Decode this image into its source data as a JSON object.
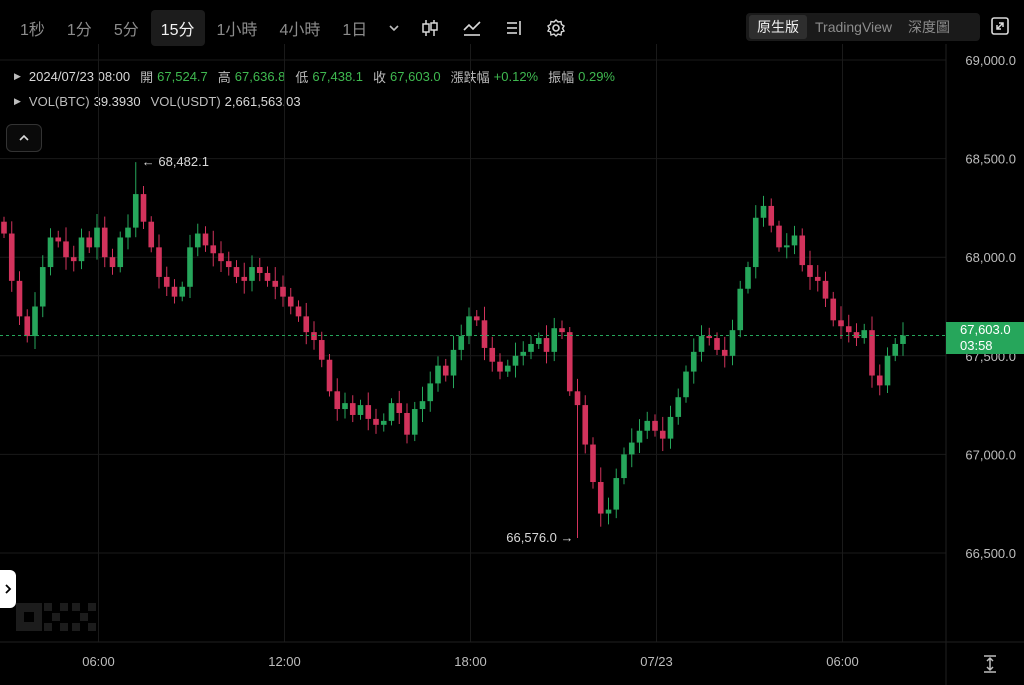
{
  "toolbar": {
    "timeframes": [
      "1秒",
      "1分",
      "5分",
      "15分",
      "1小時",
      "4小時",
      "1日"
    ],
    "active_index": 3,
    "views": [
      "原生版",
      "TradingView",
      "深度圖"
    ],
    "active_view": 0
  },
  "info": {
    "datetime": "2024/07/23 08:00",
    "open_label": "開",
    "open": "67,524.7",
    "high_label": "高",
    "high": "67,636.8",
    "low_label": "低",
    "low": "67,438.1",
    "close_label": "收",
    "close": "67,603.0",
    "change_label": "漲跌幅",
    "change": "+0.12%",
    "amplitude_label": "振幅",
    "amplitude": "0.29%"
  },
  "volume": {
    "btc_label": "VOL(BTC)",
    "btc": "39.3930",
    "usdt_label": "VOL(USDT)",
    "usdt": "2,661,563.03"
  },
  "chart_data": {
    "type": "candlestick",
    "y_ticks": [
      "69,000.0",
      "68,500.0",
      "68,000.0",
      "67,500.0",
      "67,000.0",
      "66,500.0"
    ],
    "y_tick_values": [
      69000,
      68500,
      68000,
      67500,
      67000,
      66500
    ],
    "x_ticks": [
      "06:00",
      "12:00",
      "18:00",
      "07/23",
      "06:00"
    ],
    "x_tick_bars": [
      6,
      30,
      54,
      78,
      102
    ],
    "last_price": "67,603.0",
    "last_price_value": 67603,
    "countdown": "03:58",
    "max_label": "68,482.1",
    "max_value": 68482.1,
    "max_bar": 17,
    "min_label": "66,576.0",
    "min_value": 66576,
    "min_bar": 74,
    "colors": {
      "up": "#26a65b",
      "down": "#d2335c",
      "grid": "#1a1a1a"
    },
    "closes": [
      68120,
      67880,
      67700,
      67600,
      67750,
      67950,
      68100,
      68080,
      68000,
      67980,
      68100,
      68050,
      68150,
      68000,
      67950,
      68100,
      68150,
      68320,
      68180,
      68050,
      67900,
      67850,
      67800,
      67850,
      68050,
      68120,
      68060,
      68020,
      67980,
      67950,
      67900,
      67880,
      67950,
      67920,
      67880,
      67850,
      67800,
      67750,
      67700,
      67620,
      67580,
      67480,
      67320,
      67230,
      67260,
      67200,
      67250,
      67180,
      67150,
      67170,
      67260,
      67210,
      67100,
      67230,
      67270,
      67360,
      67450,
      67400,
      67530,
      67600,
      67700,
      67680,
      67540,
      67470,
      67420,
      67450,
      67500,
      67520,
      67560,
      67590,
      67520,
      67640,
      67620,
      67320,
      67250,
      67050,
      66860,
      66700,
      66720,
      66880,
      67000,
      67060,
      67120,
      67170,
      67120,
      67080,
      67190,
      67290,
      67420,
      67520,
      67600,
      67590,
      67530,
      67500,
      67630,
      67840,
      67950,
      68200,
      68260,
      68160,
      68050,
      68060,
      68110,
      67960,
      67900,
      67880,
      67790,
      67680,
      67650,
      67620,
      67590,
      67630,
      67400,
      67350,
      67500,
      67560,
      67603
    ]
  }
}
